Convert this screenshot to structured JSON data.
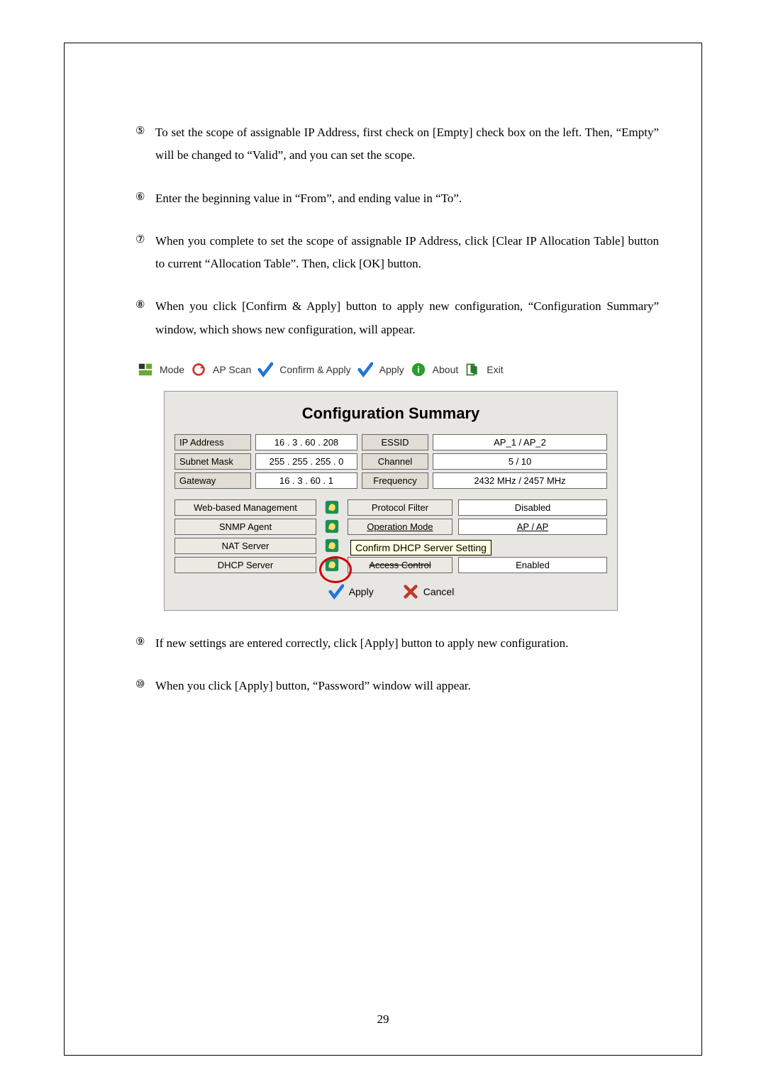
{
  "items": {
    "i5": {
      "marker": "⑤",
      "text": "To set the scope of assignable IP Address, first check on [Empty] check box on the left. Then, “Empty” will be changed to “Valid”, and you can set the scope."
    },
    "i6": {
      "marker": "⑥",
      "text": "Enter the beginning value in “From”, and ending value in “To”."
    },
    "i7": {
      "marker": "⑦",
      "text": "When you complete to set the scope of assignable IP Address, click [Clear IP Allocation Table] button to current “Allocation Table”. Then, click [OK] button."
    },
    "i8": {
      "marker": "⑧",
      "text": "When you click [Confirm & Apply] button to apply new configuration, “Configuration Summary” window, which shows new configuration, will appear."
    },
    "i9": {
      "marker": "⑨",
      "text": "If new settings are entered correctly, click [Apply] button to apply new configuration."
    },
    "i10": {
      "marker": "⑩",
      "text": "When you click [Apply] button, “Password” window will appear."
    }
  },
  "toolbar": {
    "mode": "Mode",
    "apscan": "AP Scan",
    "confirm": "Confirm & Apply",
    "apply": "Apply",
    "about": "About",
    "exit": "Exit"
  },
  "summary": {
    "title": "Configuration Summary",
    "ip_label": "IP Address",
    "ip_value": "16  .  3  . 60  . 208",
    "essid_label": "ESSID",
    "essid_value": "AP_1 / AP_2",
    "subnet_label": "Subnet Mask",
    "subnet_value": "255 . 255 . 255 .  0",
    "channel_label": "Channel",
    "channel_value": "5 / 10",
    "gateway_label": "Gateway",
    "gateway_value": "16  .  3  . 60  .  1",
    "freq_label": "Frequency",
    "freq_value": "2432 MHz / 2457 MHz",
    "webmgmt_label": "Web-based Management",
    "proto_label": "Protocol Filter",
    "proto_value": "Disabled",
    "snmp_label": "SNMP Agent",
    "opmode_label": "Operation Mode",
    "opmode_value": "AP / AP",
    "nat_label": "NAT Server",
    "access_label": "Access Control",
    "access_value": "Enabled",
    "dhcp_label": "DHCP Server",
    "tooltip": "Confirm DHCP Server Setting",
    "apply_btn": "Apply",
    "cancel_btn": "Cancel"
  },
  "page_number": "29"
}
